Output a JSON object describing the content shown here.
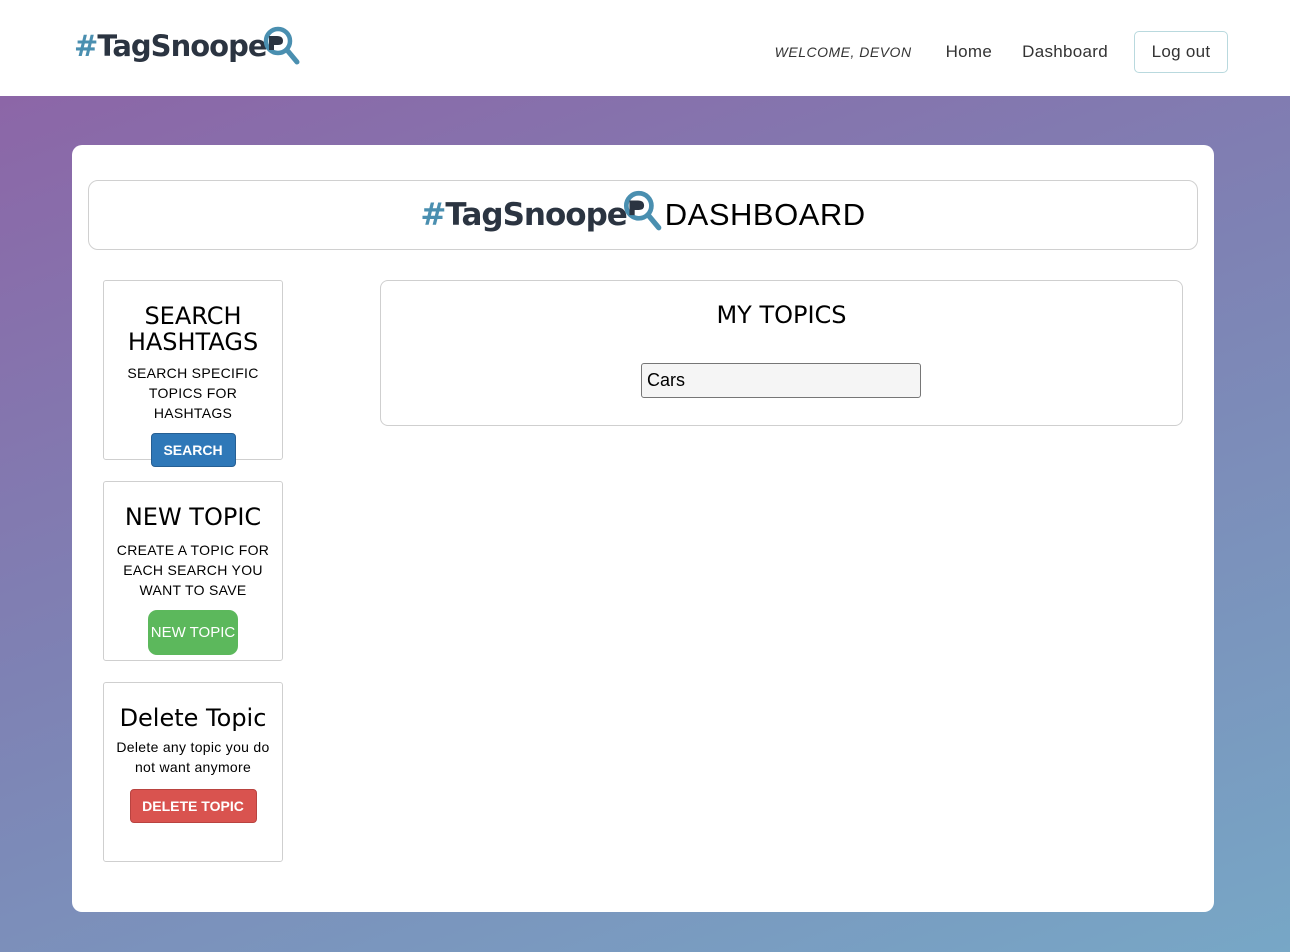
{
  "navbar": {
    "brand_hash": "#",
    "brand_name": "TagSnoope",
    "welcome": "WELCOME, DEVON",
    "links": [
      "Home",
      "Dashboard"
    ],
    "logout": "Log out"
  },
  "dashboard": {
    "title_suffix": "DASHBOARD"
  },
  "cards": {
    "search": {
      "title": "SEARCH HASHTAGS",
      "description": "SEARCH SPECIFIC TOPICS FOR HASHTAGS",
      "button": "SEARCH"
    },
    "new_topic": {
      "title": "NEW TOPIC",
      "description": "CREATE A TOPIC FOR EACH SEARCH YOU WANT TO SAVE",
      "button": "NEW TOPIC"
    },
    "delete_topic": {
      "title": "Delete Topic",
      "description": "Delete any topic you do not want anymore",
      "button": "DELETE TOPIC"
    }
  },
  "topics": {
    "title": "MY TOPICS",
    "items": [
      "Cars"
    ]
  },
  "colors": {
    "brand_dark": "#2b3441",
    "brand_accent": "#4a8fb0",
    "search_button": "#2f78b8",
    "new_button": "#5cb85c",
    "delete_button": "#d9534f"
  },
  "icons": {
    "logo": "magnifier-icon"
  }
}
